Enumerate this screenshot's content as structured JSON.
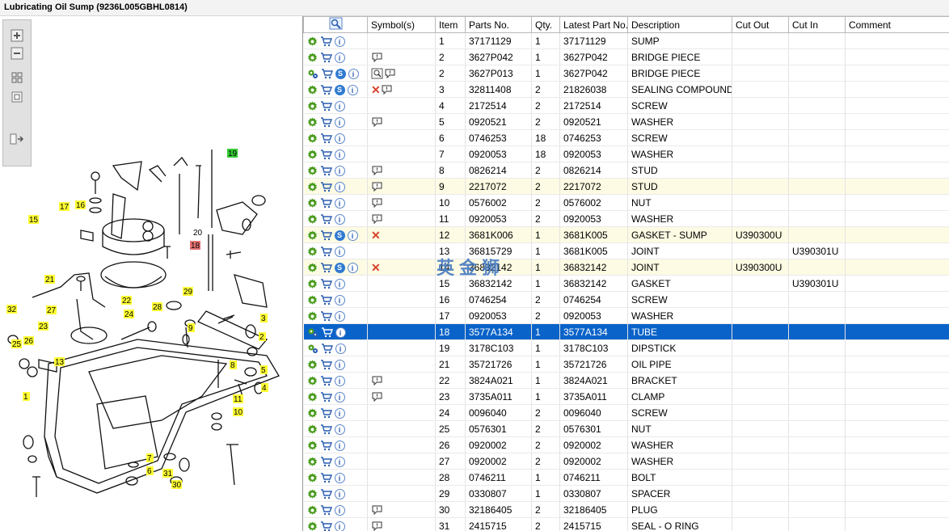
{
  "window": {
    "title": "Lubricating Oil Sump (9236L005GBHL0814)"
  },
  "toolbox": {
    "icons": [
      "zoom-in-icon",
      "zoom-out-icon",
      "fit-icon",
      "actual-size-icon",
      "panel-toggle-icon"
    ]
  },
  "diagram": {
    "callouts": [
      {
        "label": "19",
        "color": "#33cc33"
      },
      {
        "label": "18",
        "color": "#e67373"
      },
      {
        "label": "20",
        "color": "none"
      },
      {
        "label": "17",
        "color": "#ffff33"
      },
      {
        "label": "16",
        "color": "#ffff33"
      },
      {
        "label": "15",
        "color": "#ffff33"
      },
      {
        "label": "21",
        "color": "#ffff33"
      },
      {
        "label": "22",
        "color": "#ffff33"
      },
      {
        "label": "29",
        "color": "#ffff33"
      },
      {
        "label": "28",
        "color": "#ffff33"
      },
      {
        "label": "24",
        "color": "#ffff33"
      },
      {
        "label": "27",
        "color": "#ffff33"
      },
      {
        "label": "32",
        "color": "#ffff33"
      },
      {
        "label": "23",
        "color": "#ffff33"
      },
      {
        "label": "26",
        "color": "#ffff33"
      },
      {
        "label": "25",
        "color": "#ffff33"
      },
      {
        "label": "13",
        "color": "#ffff33"
      },
      {
        "label": "3",
        "color": "#ffff33"
      },
      {
        "label": "2",
        "color": "#ffff33"
      },
      {
        "label": "5",
        "color": "#ffff33"
      },
      {
        "label": "8",
        "color": "#ffff33"
      },
      {
        "label": "4",
        "color": "#ffff33"
      },
      {
        "label": "1",
        "color": "#ffff33"
      },
      {
        "label": "11",
        "color": "#ffff33"
      },
      {
        "label": "10",
        "color": "#ffff33"
      },
      {
        "label": "7",
        "color": "#ffff33"
      },
      {
        "label": "6",
        "color": "#ffff33"
      },
      {
        "label": "31",
        "color": "#ffff33"
      },
      {
        "label": "30",
        "color": "#ffff33"
      },
      {
        "label": "9",
        "color": "#ffff33"
      }
    ]
  },
  "grid": {
    "columns": [
      "",
      "Symbol(s)",
      "Item",
      "Parts No.",
      "Qty.",
      "Latest Part No.",
      "Description",
      "Cut Out",
      "Cut In",
      "Comment"
    ],
    "rows": [
      {
        "icons": "gci",
        "sym": "",
        "item": "1",
        "part": "37171129",
        "qty": "1",
        "latest": "37171129",
        "desc": "SUMP",
        "cut_out": "",
        "cut_in": "",
        "comment": "",
        "style": ""
      },
      {
        "icons": "gci",
        "sym": "b",
        "item": "2",
        "part": "3627P042",
        "qty": "1",
        "latest": "3627P042",
        "desc": "BRIDGE PIECE",
        "cut_out": "",
        "cut_in": "",
        "comment": "",
        "style": ""
      },
      {
        "icons": "Gcsi",
        "sym": "mb",
        "item": "2",
        "part": "3627P013",
        "qty": "1",
        "latest": "3627P042",
        "desc": "BRIDGE PIECE",
        "cut_out": "",
        "cut_in": "",
        "comment": "",
        "style": ""
      },
      {
        "icons": "gcsi",
        "sym": "xb",
        "item": "3",
        "part": "32811408",
        "qty": "2",
        "latest": "21826038",
        "desc": "SEALING COMPOUND",
        "cut_out": "",
        "cut_in": "",
        "comment": "",
        "style": ""
      },
      {
        "icons": "gci",
        "sym": "",
        "item": "4",
        "part": "2172514",
        "qty": "2",
        "latest": "2172514",
        "desc": "SCREW",
        "cut_out": "",
        "cut_in": "",
        "comment": "",
        "style": ""
      },
      {
        "icons": "gci",
        "sym": "b",
        "item": "5",
        "part": "0920521",
        "qty": "2",
        "latest": "0920521",
        "desc": "WASHER",
        "cut_out": "",
        "cut_in": "",
        "comment": "",
        "style": ""
      },
      {
        "icons": "gci",
        "sym": "",
        "item": "6",
        "part": "0746253",
        "qty": "18",
        "latest": "0746253",
        "desc": "SCREW",
        "cut_out": "",
        "cut_in": "",
        "comment": "",
        "style": ""
      },
      {
        "icons": "gci",
        "sym": "",
        "item": "7",
        "part": "0920053",
        "qty": "18",
        "latest": "0920053",
        "desc": "WASHER",
        "cut_out": "",
        "cut_in": "",
        "comment": "",
        "style": ""
      },
      {
        "icons": "gci",
        "sym": "b",
        "item": "8",
        "part": "0826214",
        "qty": "2",
        "latest": "0826214",
        "desc": "STUD",
        "cut_out": "",
        "cut_in": "",
        "comment": "",
        "style": ""
      },
      {
        "icons": "gci",
        "sym": "b",
        "item": "9",
        "part": "2217072",
        "qty": "2",
        "latest": "2217072",
        "desc": "STUD",
        "cut_out": "",
        "cut_in": "",
        "comment": "",
        "style": "hl"
      },
      {
        "icons": "gci",
        "sym": "b",
        "item": "10",
        "part": "0576002",
        "qty": "2",
        "latest": "0576002",
        "desc": "NUT",
        "cut_out": "",
        "cut_in": "",
        "comment": "",
        "style": ""
      },
      {
        "icons": "gci",
        "sym": "b",
        "item": "11",
        "part": "0920053",
        "qty": "2",
        "latest": "0920053",
        "desc": "WASHER",
        "cut_out": "",
        "cut_in": "",
        "comment": "",
        "style": ""
      },
      {
        "icons": "gcsi",
        "sym": "x",
        "item": "12",
        "part": "3681K006",
        "qty": "1",
        "latest": "3681K005",
        "desc": "GASKET - SUMP",
        "cut_out": "U390300U",
        "cut_in": "",
        "comment": "",
        "style": "hl"
      },
      {
        "icons": "gci",
        "sym": "",
        "item": "13",
        "part": "36815729",
        "qty": "1",
        "latest": "3681K005",
        "desc": "JOINT",
        "cut_out": "",
        "cut_in": "U390301U",
        "comment": "",
        "style": ""
      },
      {
        "icons": "gcsi",
        "sym": "x",
        "item": "14",
        "part": "36832142",
        "qty": "1",
        "latest": "36832142",
        "desc": "JOINT",
        "cut_out": "U390300U",
        "cut_in": "",
        "comment": "",
        "style": "hl"
      },
      {
        "icons": "gci",
        "sym": "",
        "item": "15",
        "part": "36832142",
        "qty": "1",
        "latest": "36832142",
        "desc": "GASKET",
        "cut_out": "",
        "cut_in": "U390301U",
        "comment": "",
        "style": ""
      },
      {
        "icons": "gci",
        "sym": "",
        "item": "16",
        "part": "0746254",
        "qty": "2",
        "latest": "0746254",
        "desc": "SCREW",
        "cut_out": "",
        "cut_in": "",
        "comment": "",
        "style": ""
      },
      {
        "icons": "gci",
        "sym": "",
        "item": "17",
        "part": "0920053",
        "qty": "2",
        "latest": "0920053",
        "desc": "WASHER",
        "cut_out": "",
        "cut_in": "",
        "comment": "",
        "style": ""
      },
      {
        "icons": "Gci",
        "sym": "",
        "item": "18",
        "part": "3577A134",
        "qty": "1",
        "latest": "3577A134",
        "desc": "TUBE",
        "cut_out": "",
        "cut_in": "",
        "comment": "",
        "style": "sel"
      },
      {
        "icons": "Gci",
        "sym": "",
        "item": "19",
        "part": "3178C103",
        "qty": "1",
        "latest": "3178C103",
        "desc": "DIPSTICK",
        "cut_out": "",
        "cut_in": "",
        "comment": "",
        "style": ""
      },
      {
        "icons": "gci",
        "sym": "",
        "item": "21",
        "part": "35721726",
        "qty": "1",
        "latest": "35721726",
        "desc": "OIL PIPE",
        "cut_out": "",
        "cut_in": "",
        "comment": "",
        "style": ""
      },
      {
        "icons": "gci",
        "sym": "b",
        "item": "22",
        "part": "3824A021",
        "qty": "1",
        "latest": "3824A021",
        "desc": "BRACKET",
        "cut_out": "",
        "cut_in": "",
        "comment": "",
        "style": ""
      },
      {
        "icons": "gci",
        "sym": "b",
        "item": "23",
        "part": "3735A011",
        "qty": "1",
        "latest": "3735A011",
        "desc": "CLAMP",
        "cut_out": "",
        "cut_in": "",
        "comment": "",
        "style": ""
      },
      {
        "icons": "gci",
        "sym": "",
        "item": "24",
        "part": "0096040",
        "qty": "2",
        "latest": "0096040",
        "desc": "SCREW",
        "cut_out": "",
        "cut_in": "",
        "comment": "",
        "style": ""
      },
      {
        "icons": "gci",
        "sym": "",
        "item": "25",
        "part": "0576301",
        "qty": "2",
        "latest": "0576301",
        "desc": "NUT",
        "cut_out": "",
        "cut_in": "",
        "comment": "",
        "style": ""
      },
      {
        "icons": "gci",
        "sym": "",
        "item": "26",
        "part": "0920002",
        "qty": "2",
        "latest": "0920002",
        "desc": "WASHER",
        "cut_out": "",
        "cut_in": "",
        "comment": "",
        "style": ""
      },
      {
        "icons": "gci",
        "sym": "",
        "item": "27",
        "part": "0920002",
        "qty": "2",
        "latest": "0920002",
        "desc": "WASHER",
        "cut_out": "",
        "cut_in": "",
        "comment": "",
        "style": ""
      },
      {
        "icons": "gci",
        "sym": "",
        "item": "28",
        "part": "0746211",
        "qty": "1",
        "latest": "0746211",
        "desc": "BOLT",
        "cut_out": "",
        "cut_in": "",
        "comment": "",
        "style": ""
      },
      {
        "icons": "gci",
        "sym": "",
        "item": "29",
        "part": "0330807",
        "qty": "1",
        "latest": "0330807",
        "desc": "SPACER",
        "cut_out": "",
        "cut_in": "",
        "comment": "",
        "style": ""
      },
      {
        "icons": "gci",
        "sym": "b",
        "item": "30",
        "part": "32186405",
        "qty": "2",
        "latest": "32186405",
        "desc": "PLUG",
        "cut_out": "",
        "cut_in": "",
        "comment": "",
        "style": ""
      },
      {
        "icons": "gci",
        "sym": "b",
        "item": "31",
        "part": "2415715",
        "qty": "2",
        "latest": "2415715",
        "desc": "SEAL - O RING",
        "cut_out": "",
        "cut_in": "",
        "comment": "",
        "style": ""
      }
    ]
  },
  "watermark": {
    "text": "英金狮",
    "color": "#3a72c0"
  }
}
